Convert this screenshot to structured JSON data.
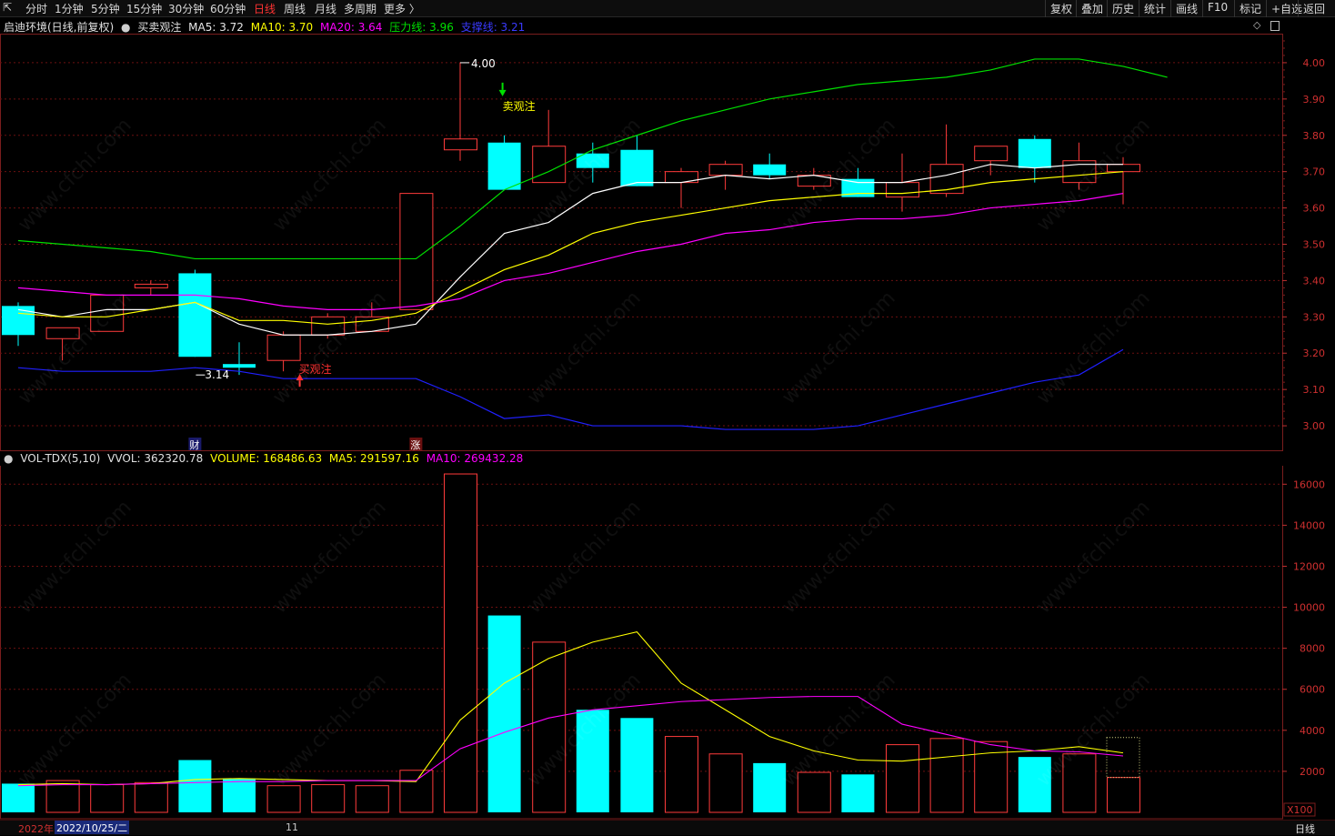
{
  "toolbar": {
    "back_glyph": "⇱",
    "periods": [
      "分时",
      "1分钟",
      "5分钟",
      "15分钟",
      "30分钟",
      "60分钟",
      "日线",
      "周线",
      "月线",
      "多周期",
      "更多 〉"
    ],
    "active_period": "日线",
    "right_buttons": [
      "复权",
      "叠加",
      "历史",
      "统计",
      "画线",
      "F10",
      "标记",
      "+自选",
      "返回"
    ]
  },
  "main_legend": {
    "stock": "启迪环境(日线,前复权)",
    "indicator": "买卖观注",
    "ma5": "MA5: 3.72",
    "ma10": "MA10: 3.70",
    "ma20": "MA20: 3.64",
    "pressure": "压力线: 3.96",
    "support": "支撑线: 3.21"
  },
  "vol_legend": {
    "name": "VOL-TDX(5,10)",
    "vvol": "VVOL: 362320.78",
    "volume": "VOLUME: 168486.63",
    "ma5": "MA5: 291597.16",
    "ma10": "MA10: 269432.28"
  },
  "annotations": {
    "high_label": "4.00",
    "low_label": "3.14",
    "sell_signal": "卖观注",
    "buy_signal": "买观注",
    "fin_marker": "财",
    "up_marker": "涨",
    "vol_unit": "X100"
  },
  "bottom": {
    "year": "2022年",
    "date": "2022/10/25/二",
    "month": "11",
    "period": "日线"
  },
  "watermark": "www.cfchi.com",
  "colors": {
    "up": "#ff3b3b",
    "down": "#00ffff",
    "ma5": "#ffffff",
    "ma10": "#ffff00",
    "ma20": "#ff00ff",
    "pressure": "#00e000",
    "support": "#2020ff",
    "grid": "#6b1010"
  },
  "chart_data": [
    {
      "type": "candlestick",
      "title": "启迪环境(日线,前复权)",
      "y_ticks": [
        3.0,
        3.1,
        3.2,
        3.3,
        3.4,
        3.5,
        3.6,
        3.7,
        3.8,
        3.9,
        4.0
      ],
      "ylim": [
        2.93,
        4.08
      ],
      "candles": [
        {
          "o": 3.33,
          "h": 3.34,
          "l": 3.22,
          "c": 3.25
        },
        {
          "o": 3.24,
          "h": 3.27,
          "l": 3.18,
          "c": 3.27
        },
        {
          "o": 3.26,
          "h": 3.36,
          "l": 3.26,
          "c": 3.36
        },
        {
          "o": 3.38,
          "h": 3.4,
          "l": 3.36,
          "c": 3.39
        },
        {
          "o": 3.42,
          "h": 3.43,
          "l": 3.19,
          "c": 3.19
        },
        {
          "o": 3.17,
          "h": 3.23,
          "l": 3.14,
          "c": 3.16
        },
        {
          "o": 3.18,
          "h": 3.26,
          "l": 3.15,
          "c": 3.25
        },
        {
          "o": 3.25,
          "h": 3.31,
          "l": 3.24,
          "c": 3.3
        },
        {
          "o": 3.26,
          "h": 3.34,
          "l": 3.26,
          "c": 3.3
        },
        {
          "o": 3.32,
          "h": 3.64,
          "l": 3.32,
          "c": 3.64
        },
        {
          "o": 3.76,
          "h": 4.0,
          "l": 3.73,
          "c": 3.79
        },
        {
          "o": 3.78,
          "h": 3.8,
          "l": 3.65,
          "c": 3.65
        },
        {
          "o": 3.67,
          "h": 3.87,
          "l": 3.67,
          "c": 3.77
        },
        {
          "o": 3.75,
          "h": 3.78,
          "l": 3.67,
          "c": 3.71
        },
        {
          "o": 3.76,
          "h": 3.8,
          "l": 3.66,
          "c": 3.66
        },
        {
          "o": 3.67,
          "h": 3.71,
          "l": 3.6,
          "c": 3.7
        },
        {
          "o": 3.69,
          "h": 3.73,
          "l": 3.65,
          "c": 3.72
        },
        {
          "o": 3.72,
          "h": 3.75,
          "l": 3.68,
          "c": 3.69
        },
        {
          "o": 3.66,
          "h": 3.71,
          "l": 3.65,
          "c": 3.69
        },
        {
          "o": 3.68,
          "h": 3.71,
          "l": 3.63,
          "c": 3.63
        },
        {
          "o": 3.63,
          "h": 3.75,
          "l": 3.59,
          "c": 3.67
        },
        {
          "o": 3.64,
          "h": 3.83,
          "l": 3.63,
          "c": 3.72
        },
        {
          "o": 3.73,
          "h": 3.77,
          "l": 3.69,
          "c": 3.77
        },
        {
          "o": 3.79,
          "h": 3.8,
          "l": 3.67,
          "c": 3.71
        },
        {
          "o": 3.67,
          "h": 3.78,
          "l": 3.65,
          "c": 3.73
        },
        {
          "o": 3.7,
          "h": 3.74,
          "l": 3.61,
          "c": 3.72
        }
      ],
      "lines": {
        "MA5": [
          3.32,
          3.3,
          3.32,
          3.32,
          3.34,
          3.28,
          3.25,
          3.25,
          3.26,
          3.28,
          3.41,
          3.53,
          3.56,
          3.64,
          3.67,
          3.67,
          3.69,
          3.68,
          3.69,
          3.67,
          3.67,
          3.69,
          3.72,
          3.71,
          3.72,
          3.72
        ],
        "MA10": [
          3.31,
          3.3,
          3.3,
          3.32,
          3.34,
          3.29,
          3.29,
          3.28,
          3.29,
          3.31,
          3.37,
          3.43,
          3.47,
          3.53,
          3.56,
          3.58,
          3.6,
          3.62,
          3.63,
          3.64,
          3.64,
          3.65,
          3.67,
          3.68,
          3.69,
          3.7
        ],
        "MA20": [
          3.38,
          3.37,
          3.36,
          3.36,
          3.36,
          3.35,
          3.33,
          3.32,
          3.32,
          3.33,
          3.35,
          3.4,
          3.42,
          3.45,
          3.48,
          3.5,
          3.53,
          3.54,
          3.56,
          3.57,
          3.57,
          3.58,
          3.6,
          3.61,
          3.62,
          3.64
        ],
        "压力线": [
          3.51,
          3.5,
          3.49,
          3.48,
          3.46,
          3.46,
          3.46,
          3.46,
          3.46,
          3.46,
          3.55,
          3.65,
          3.7,
          3.76,
          3.8,
          3.84,
          3.87,
          3.9,
          3.92,
          3.94,
          3.95,
          3.96,
          3.98,
          4.01,
          4.01,
          3.99,
          3.96
        ],
        "支撑线": [
          3.16,
          3.15,
          3.15,
          3.15,
          3.16,
          3.15,
          3.13,
          3.13,
          3.13,
          3.13,
          3.08,
          3.02,
          3.03,
          3.0,
          3.0,
          3.0,
          2.99,
          2.99,
          2.99,
          3.0,
          3.03,
          3.06,
          3.09,
          3.12,
          3.14,
          3.21
        ]
      }
    },
    {
      "type": "bar",
      "title": "VOL-TDX(5,10)",
      "unit": "X100",
      "y_ticks": [
        2000,
        4000,
        6000,
        8000,
        10000,
        12000,
        14000,
        16000
      ],
      "ylim": [
        0,
        16900
      ],
      "volumes": [
        1400,
        1550,
        1350,
        1450,
        2550,
        1650,
        1300,
        1350,
        1300,
        2050,
        16500,
        9600,
        8300,
        5000,
        4600,
        3700,
        2850,
        2400,
        1950,
        1850,
        3300,
        3600,
        3450,
        2700,
        2850,
        1700
      ],
      "vol_up": [
        false,
        true,
        true,
        true,
        false,
        false,
        true,
        true,
        true,
        true,
        true,
        false,
        true,
        false,
        false,
        true,
        true,
        false,
        true,
        false,
        true,
        true,
        true,
        false,
        true,
        true
      ],
      "ma5": [
        1350,
        1400,
        1350,
        1400,
        1600,
        1650,
        1600,
        1550,
        1550,
        1500,
        4500,
        6300,
        7500,
        8300,
        8800,
        6300,
        5000,
        3700,
        3000,
        2550,
        2500,
        2700,
        2900,
        3000,
        3200,
        2900
      ],
      "ma10": [
        1300,
        1350,
        1350,
        1400,
        1450,
        1500,
        1500,
        1550,
        1550,
        1550,
        3100,
        3900,
        4600,
        5000,
        5200,
        5400,
        5500,
        5600,
        5650,
        5650,
        4300,
        3800,
        3300,
        3000,
        2950,
        2750
      ]
    }
  ]
}
